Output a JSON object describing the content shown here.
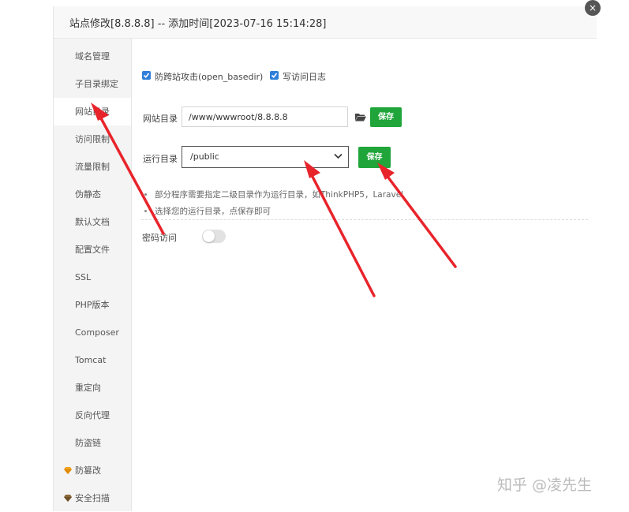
{
  "dialog": {
    "title": "站点修改[8.8.8.8] -- 添加时间[2023-07-16 15:14:28]",
    "close_icon": "×"
  },
  "sidebar": {
    "items": [
      {
        "label": "域名管理"
      },
      {
        "label": "子目录绑定"
      },
      {
        "label": "网站目录",
        "active": true
      },
      {
        "label": "访问限制"
      },
      {
        "label": "流量限制"
      },
      {
        "label": "伪静态"
      },
      {
        "label": "默认文档"
      },
      {
        "label": "配置文件"
      },
      {
        "label": "SSL"
      },
      {
        "label": "PHP版本"
      },
      {
        "label": "Composer"
      },
      {
        "label": "Tomcat"
      },
      {
        "label": "重定向"
      },
      {
        "label": "反向代理"
      },
      {
        "label": "防盗链"
      },
      {
        "label": "防篡改",
        "icon": "gem-icon"
      },
      {
        "label": "安全扫描",
        "icon": "gem-icon"
      }
    ]
  },
  "options": {
    "anti_xss_label": "防跨站攻击(open_basedir)",
    "anti_xss_checked": true,
    "access_log_label": "写访问日志",
    "access_log_checked": true
  },
  "site_dir": {
    "label": "网站目录",
    "value": "/www/wwwroot/8.8.8.8",
    "save_label": "保存"
  },
  "run_dir": {
    "label": "运行目录",
    "value": "/public",
    "save_label": "保存"
  },
  "notes": [
    "部分程序需要指定二级目录作为运行目录，如ThinkPHP5，Laravel",
    "选择您的运行目录，点保存即可"
  ],
  "password_access": {
    "label": "密码访问",
    "enabled": false
  },
  "watermark": "知乎 @凌先生",
  "colors": {
    "accent_blue": "#2f7ed8",
    "save_green": "#20a53a",
    "arrow_red": "#e8242b"
  }
}
